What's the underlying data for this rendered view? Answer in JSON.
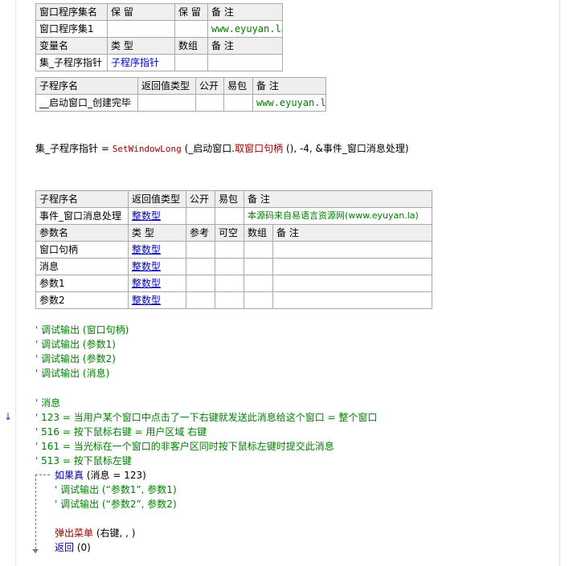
{
  "table1": {
    "header": [
      "窗口程序集名",
      "保 留",
      "保 留",
      "备 注"
    ],
    "row": [
      "窗口程序集1",
      "",
      "",
      "www.eyuyan.la"
    ],
    "var_header": [
      "变量名",
      "类 型",
      "数组",
      "备 注"
    ],
    "var_row": [
      "集_子程序指针",
      "子程序指针",
      "",
      ""
    ]
  },
  "table2": {
    "header": [
      "子程序名",
      "返回值类型",
      "公开",
      "易包",
      "备 注"
    ],
    "row": [
      "__启动窗口_创建完毕",
      "",
      "",
      "",
      "www.eyuyan.la"
    ]
  },
  "code1": {
    "var": "集_子程序指针",
    "eq": " = ",
    "func": "SetWindowLong",
    "args_open": " (",
    "arg1": "_启动窗口.",
    "arg1_method": "取窗口句柄",
    "arg1_tail": " (), ",
    "arg2": "-4",
    "arg3": ", &事件_窗口消息处理",
    "close": ")"
  },
  "table3": {
    "header": [
      "子程序名",
      "返回值类型",
      "公开",
      "易包",
      "备 注"
    ],
    "row": [
      "事件_窗口消息处理",
      "整数型",
      "",
      "",
      "本源码来自易语言资源网(www.eyuyan.la)"
    ],
    "param_header": [
      "参数名",
      "类 型",
      "参考",
      "可空",
      "数组",
      "备 注"
    ],
    "params": [
      {
        "name": "窗口句柄",
        "type": "整数型"
      },
      {
        "name": "消息",
        "type": "整数型"
      },
      {
        "name": "参数1",
        "type": "整数型"
      },
      {
        "name": "参数2",
        "type": "整数型"
      }
    ]
  },
  "comments1": [
    "' 调试输出 (窗口句柄)",
    "' 调试输出 (参数1)",
    "' 调试输出 (参数2)",
    "' 调试输出 (消息)"
  ],
  "comments2": [
    "' 消息",
    "' 123 = 当用户某个窗口中点击了一下右键就发送此消息给这个窗口 = 整个窗口",
    "' 516 = 按下鼠标右键 = 用户区域 右键",
    "' 161 = 当光标在一个窗口的非客户区同时按下鼠标左键时提交此消息",
    "' 513 = 按下鼠标左键"
  ],
  "if_block": {
    "keyword": "如果真",
    "condition": " (消息 = 123)",
    "inner_comments": [
      "' 调试输出 (“参数1”, 参数1)",
      "' 调试输出 (“参数2”, 参数2)"
    ],
    "menu_call": "弹出菜单",
    "menu_args": " (右键, , )",
    "return_kw": "返回",
    "return_args": " (0)"
  },
  "gutter": {
    "arrow_icon": "down-arrow-icon",
    "arrow_glyph": "↓"
  }
}
